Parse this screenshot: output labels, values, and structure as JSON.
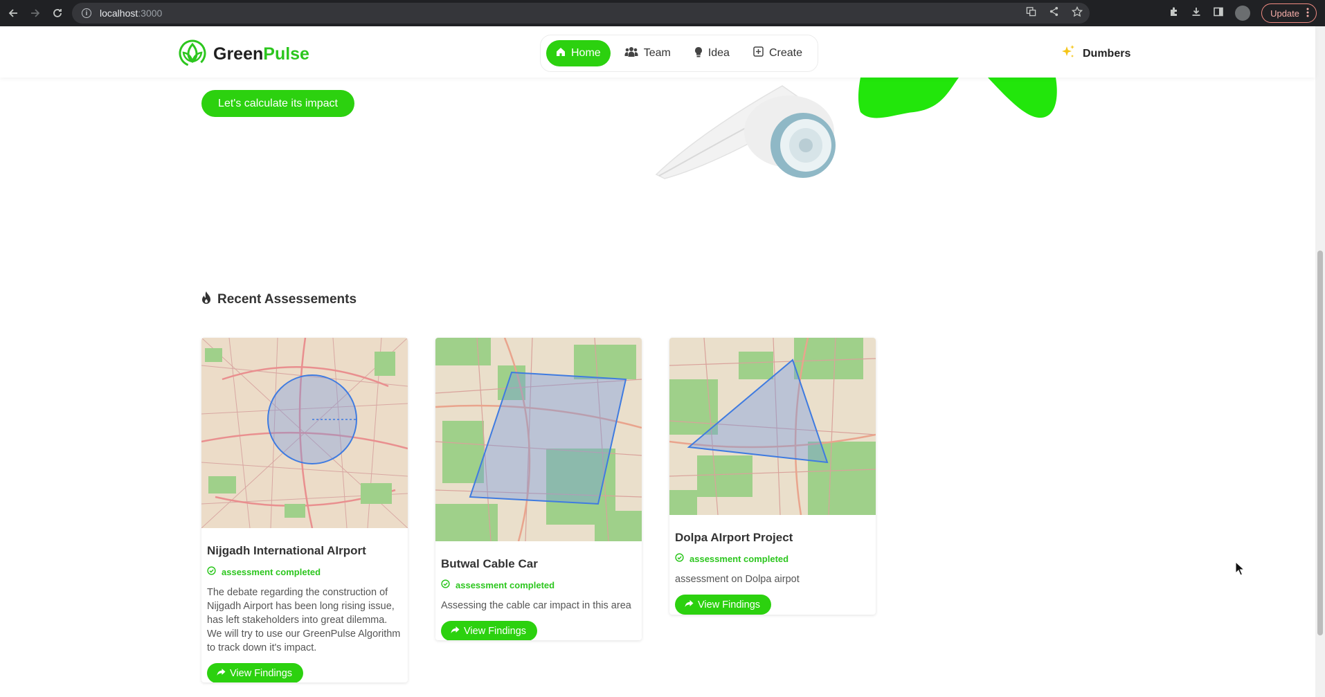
{
  "browser": {
    "url_host": "localhost",
    "url_port": ":3000",
    "update_label": "Update"
  },
  "header": {
    "logo_part1": "Green",
    "logo_part2": "Pulse",
    "nav": [
      {
        "label": "Home",
        "icon": "home-icon",
        "active": true
      },
      {
        "label": "Team",
        "icon": "team-icon",
        "active": false
      },
      {
        "label": "Idea",
        "icon": "lightbulb-icon",
        "active": false
      },
      {
        "label": "Create",
        "icon": "plus-square-icon",
        "active": false
      }
    ],
    "user_name": "Dumbers"
  },
  "hero": {
    "cta_label": "Let's calculate its impact"
  },
  "section": {
    "title": "Recent Assessements"
  },
  "cards": [
    {
      "title": "Nijgadh International AIrport",
      "status": "assessment completed",
      "description": "The debate regarding the construction of Nijgadh Airport has been long rising issue, has left stakeholders into great dilemma. We will try to use our GreenPulse Algorithm to track down it's impact.",
      "button": "View Findings"
    },
    {
      "title": "Butwal Cable Car",
      "status": "assessment completed",
      "description": "Assessing the cable car impact in this area",
      "button": "View Findings"
    },
    {
      "title": "Dolpa AIrport Project",
      "status": "assessment completed",
      "description": "assessment on Dolpa airpot",
      "button": "View Findings"
    }
  ],
  "colors": {
    "accent": "#2cd10f",
    "brand_text": "#2cc61e"
  }
}
